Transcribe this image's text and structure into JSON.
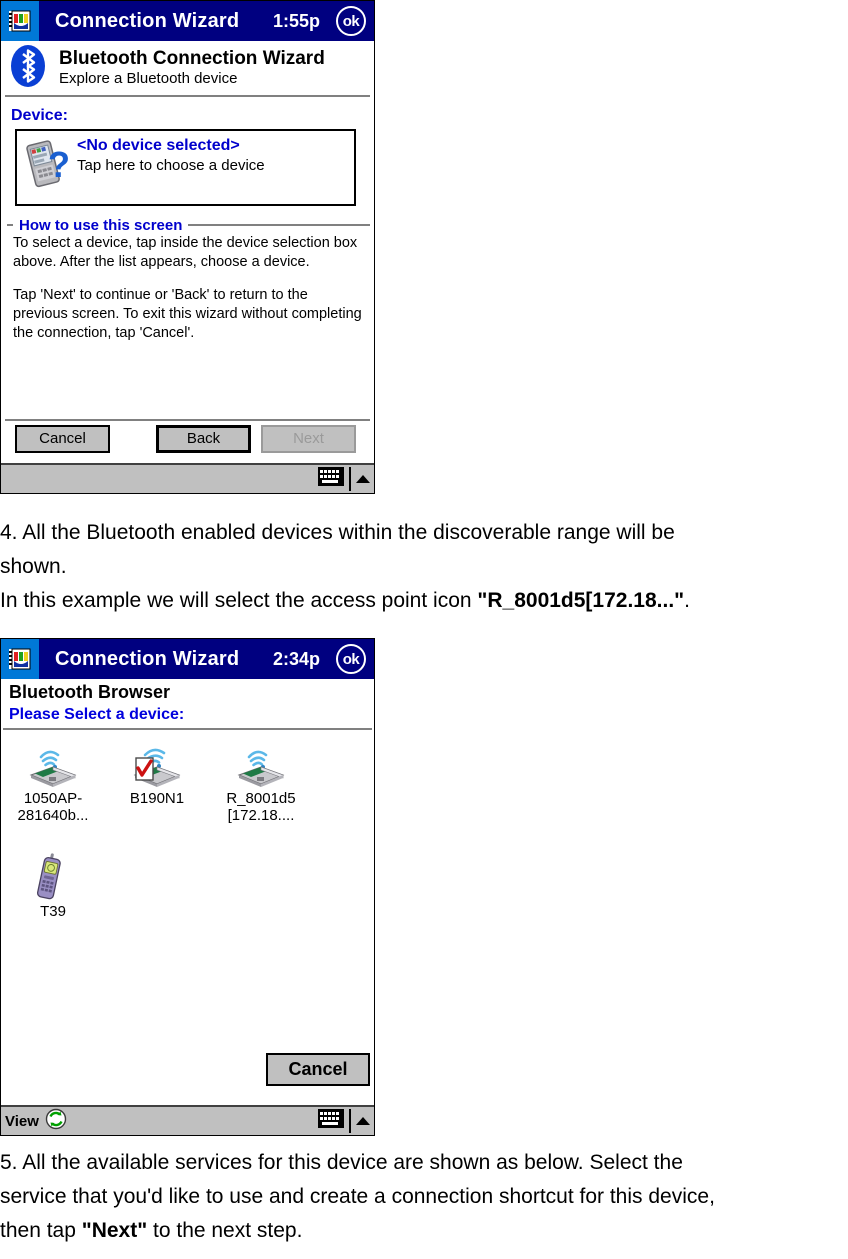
{
  "document": {
    "paragraphs": [
      {
        "id": "step4",
        "lines": [
          "4. All the Bluetooth enabled devices within the discoverable range will be",
          "shown.",
          "In this example we will select the access point icon "
        ],
        "line1": "4. All the Bluetooth enabled devices within the discoverable range will be",
        "line2": "shown.",
        "line3_prefix": "In this example we will select the access point icon ",
        "line3_bold": "\"R_8001d5[172.18...\"",
        "line3_suffix": "."
      },
      {
        "id": "step5",
        "line1": "5. All the available services for this device are shown as below. Select the",
        "line2": "service that you'd like to use and create a connection shortcut for this device,",
        "line3_prefix": "then tap ",
        "line3_bold": "\"Next\"",
        "line3_suffix": " to the next step."
      }
    ]
  },
  "screen_one": {
    "titlebar": {
      "app_icon": "connection-wizard-icon",
      "title": "Connection Wizard",
      "time": "1:55p",
      "ok_label": "ok"
    },
    "header": {
      "icon": "bluetooth-logo-icon",
      "title": "Bluetooth Connection Wizard",
      "subtitle": "Explore a Bluetooth device"
    },
    "device_section": {
      "label": "Device:",
      "icon": "unknown-device-question-icon",
      "selected_text": "<No device selected>",
      "hint_text": "Tap here to choose a device"
    },
    "howto": {
      "legend": "How to use this screen",
      "paragraph1": "To select a device, tap inside the device selection box above. After the list appears, choose a device.",
      "paragraph2": "Tap 'Next' to continue or 'Back' to return to the previous screen. To exit this wizard without completing the connection, tap 'Cancel'."
    },
    "buttons": {
      "cancel": "Cancel",
      "back": "Back",
      "next": "Next",
      "next_state": "disabled",
      "back_state": "default"
    },
    "taskbar": {
      "sip_icon": "keyboard-icon",
      "sip_arrow_icon": "chevron-up-icon"
    }
  },
  "screen_two": {
    "titlebar": {
      "app_icon": "connection-wizard-icon",
      "title": "Connection Wizard",
      "time": "2:34p",
      "ok_label": "ok"
    },
    "header": {
      "title": "Bluetooth Browser",
      "prompt": "Please Select a device:"
    },
    "devices": [
      {
        "icon": "access-point-icon",
        "caption": "1050AP-\n281640b..."
      },
      {
        "icon": "access-point-checked-icon",
        "caption": "B190N1"
      },
      {
        "icon": "access-point-icon",
        "caption": "R_8001d5\n[172.18...."
      },
      {
        "icon": "mobile-phone-icon",
        "caption": "T39"
      }
    ],
    "buttons": {
      "cancel": "Cancel"
    },
    "taskbar": {
      "view_label": "View",
      "refresh_icon": "refresh-icon",
      "sip_icon": "keyboard-icon",
      "sip_arrow_icon": "chevron-up-icon"
    }
  },
  "colors": {
    "titlebar_bg": "#000080",
    "titlebar_icon_bg": "#0078d7",
    "accent_blue": "#0000cc",
    "chrome_gray": "#c0c0c0",
    "bluetooth_blue": "#0a3fd4",
    "refresh_green": "#00a000"
  }
}
